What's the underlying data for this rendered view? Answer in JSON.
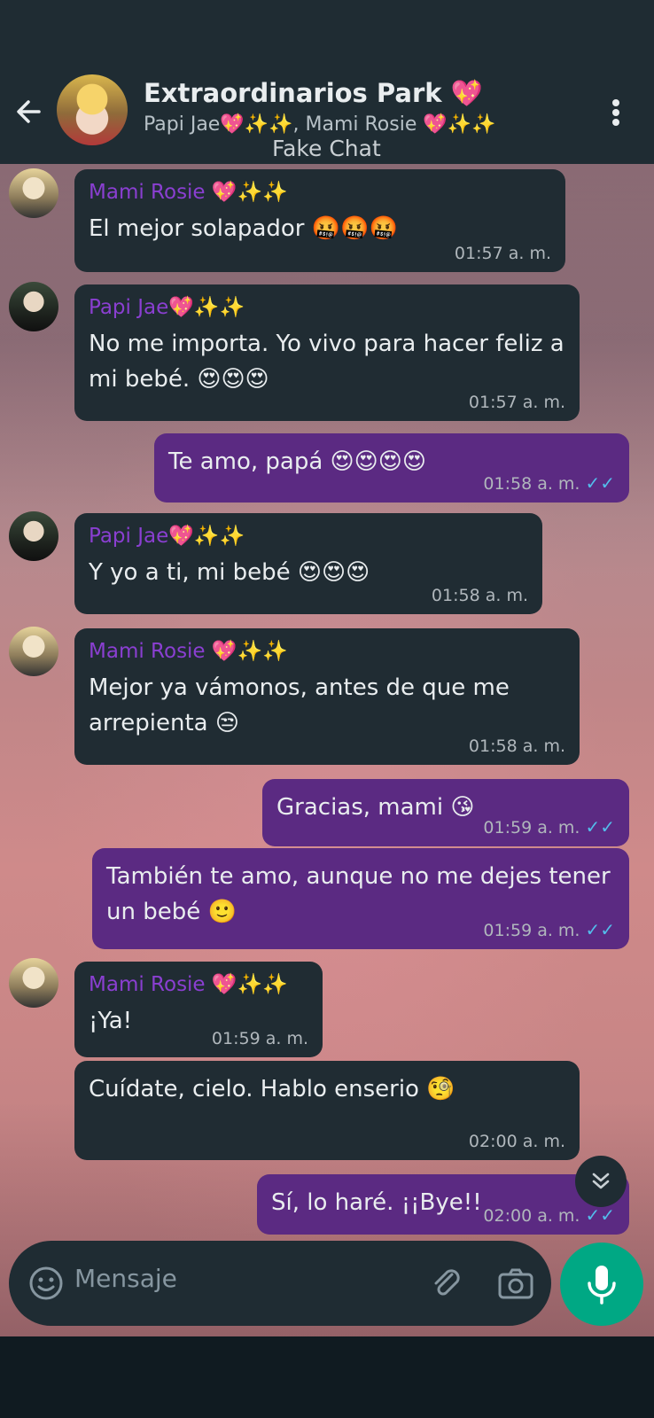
{
  "header": {
    "title": "Extraordinarios Park 💖",
    "subtitle": "Papi Jae💖✨✨, Mami Rosie 💖✨✨",
    "overlay_label": "Fake Chat"
  },
  "messages": [
    {
      "sender": "Mami Rosie 💖✨✨",
      "text": "El mejor solapador 🤬🤬🤬",
      "time": "01:57 a. m."
    },
    {
      "sender": "Papi Jae💖✨✨",
      "text": "No me importa. Yo vivo para hacer feliz a mi bebé. 😍😍😍",
      "time": "01:57 a. m."
    },
    {
      "text": "Te amo, papá 😍😍😍😍",
      "time": "01:58 a. m.",
      "ticks": "✓✓"
    },
    {
      "sender": "Papi Jae💖✨✨",
      "text": "Y yo a ti, mi bebé 😍😍😍",
      "time": "01:58 a. m."
    },
    {
      "sender": "Mami Rosie 💖✨✨",
      "text": "Mejor ya vámonos, antes de que me arrepienta 😒",
      "time": "01:58 a. m."
    },
    {
      "text": "Gracias, mami 😘",
      "time": "01:59 a. m.",
      "ticks": "✓✓"
    },
    {
      "text": "También te amo, aunque no me dejes tener un bebé 🙂",
      "time": "01:59 a. m.",
      "ticks": "✓✓"
    },
    {
      "sender": "Mami Rosie 💖✨✨",
      "text": "¡Ya!",
      "time": "01:59 a. m."
    },
    {
      "text": "Cuídate, cielo. Hablo enserio 🧐",
      "time": "02:00 a. m."
    },
    {
      "text": "Sí, lo haré. ¡¡Bye!!",
      "time": "02:00 a. m.",
      "ticks": "✓✓"
    }
  ],
  "input": {
    "placeholder": "Mensaje"
  },
  "icons": {
    "back": "back-arrow-icon",
    "menu": "more-vertical-icon",
    "scroll": "chevrons-down-icon",
    "emoji": "emoji-icon",
    "attach": "paperclip-icon",
    "camera": "camera-icon",
    "mic": "microphone-icon"
  },
  "colors": {
    "header": "#1f2c33",
    "incoming_bubble": "#202c33",
    "outgoing_bubble": "#5b2a82",
    "sender_name": "#8a3fd1",
    "read_ticks": "#53bdeb",
    "mic_button": "#00a884"
  }
}
